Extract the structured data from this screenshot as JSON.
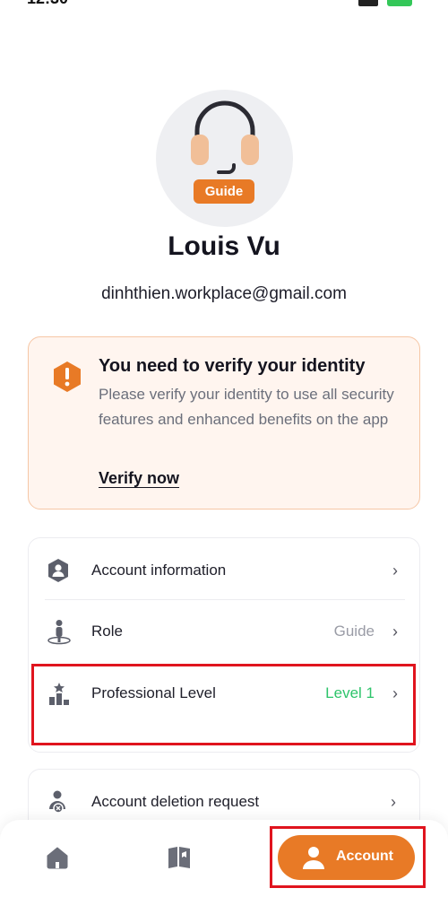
{
  "status_bar": {
    "time": "12:30"
  },
  "profile": {
    "role_badge": "Guide",
    "name": "Louis Vu",
    "email": "dinhthien.workplace@gmail.com"
  },
  "verify": {
    "title": "You need to verify your identity",
    "description": "Please verify your identity to use all security features and enhanced benefits on the app",
    "link": "Verify now"
  },
  "menu": {
    "account_info": {
      "label": "Account information",
      "value": ""
    },
    "role": {
      "label": "Role",
      "value": "Guide"
    },
    "professional": {
      "label": "Professional Level",
      "value": "Level 1"
    },
    "deletion": {
      "label": "Account deletion request"
    }
  },
  "bottom_nav": {
    "home": {
      "icon": "home-icon"
    },
    "guide": {
      "icon": "book-icon"
    },
    "account": {
      "label": "Account",
      "icon": "user-icon"
    }
  },
  "colors": {
    "accent": "#e87a26",
    "level_green": "#2ec46b",
    "highlight_red": "#e0141e"
  }
}
